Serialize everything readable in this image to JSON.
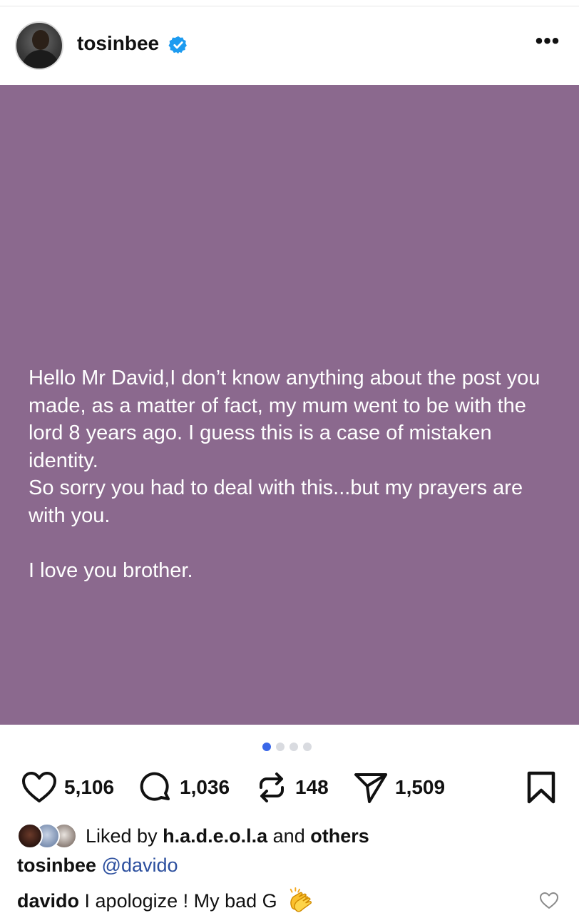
{
  "header": {
    "username": "tosinbee",
    "verified_icon": "verified-badge-icon",
    "more_icon": "more-options-icon",
    "more_label": "•••"
  },
  "post": {
    "background": "#8b698e",
    "text": "Hello Mr David,I don’t know anything about the post you made, as a matter of fact, my mum went to be with the lord 8 years ago. I guess this is a case of mistaken identity.\nSo sorry you had to deal with this...but my prayers are with you.\n\nI love you brother.",
    "carousel": {
      "total": 4,
      "current": 1
    }
  },
  "actions": {
    "likes": "5,106",
    "comments": "1,036",
    "reposts": "148",
    "shares": "1,509"
  },
  "liked_by": {
    "prefix": "Liked by",
    "user": "h.a.d.e.o.l.a",
    "joiner": "and",
    "others": "others"
  },
  "caption": {
    "username": "tosinbee",
    "mention": "@davido"
  },
  "comment": {
    "username": "davido",
    "text": "I apologize ! My bad G",
    "emoji_icon": "clapping-hands-icon"
  },
  "colors": {
    "accent": "#3a67e8",
    "verified": "#1d9bf0",
    "mention": "#2c4f9e"
  }
}
